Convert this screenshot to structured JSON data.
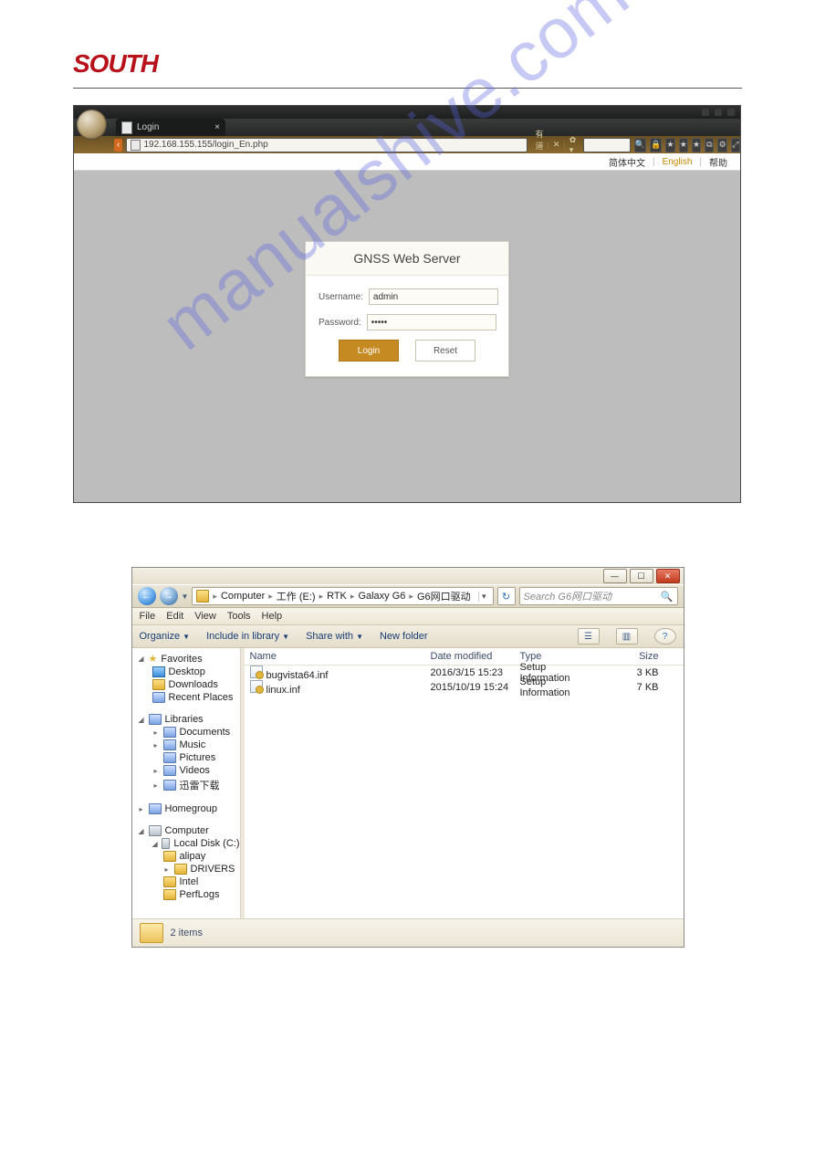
{
  "logo_text": "SOUTH",
  "watermark": "manualshive.com",
  "browser": {
    "tab_title": "Login",
    "url": "192.168.155.155/login_En.php",
    "url_right_1": "有道 ▾",
    "url_right_2": "✕",
    "url_right_3": "✿ ▾",
    "search_icon": "🔍",
    "toolbar_icons": [
      "🔒",
      "★",
      "★",
      "★",
      "⧉",
      "⚙",
      "⤢"
    ],
    "lang_cn": "简体中文",
    "lang_en": "English",
    "lang_help": "帮助"
  },
  "login": {
    "title": "GNSS Web Server",
    "username_label": "Username:",
    "password_label": "Password:",
    "username_value": "admin",
    "password_value": "•••••",
    "login_btn": "Login",
    "reset_btn": "Reset"
  },
  "explorer": {
    "win_min": "—",
    "win_max": "☐",
    "win_close": "✕",
    "back": "←",
    "forward": "→",
    "crumbs": [
      "Computer",
      "工作 (E:)",
      "RTK",
      "Galaxy G6",
      "G6网口驱动"
    ],
    "refresh": "↻",
    "search_placeholder": "Search G6网口驱动",
    "menu": [
      "File",
      "Edit",
      "View",
      "Tools",
      "Help"
    ],
    "toolbar": {
      "organize": "Organize",
      "include": "Include in library",
      "share": "Share with",
      "newfolder": "New folder",
      "view_icon": "☰",
      "preview_icon": "▥",
      "help_icon": "?"
    },
    "columns": {
      "name": "Name",
      "date": "Date modified",
      "type": "Type",
      "size": "Size"
    },
    "files": [
      {
        "name": "bugvista64.inf",
        "date": "2016/3/15 15:23",
        "type": "Setup Information",
        "size": "3 KB"
      },
      {
        "name": "linux.inf",
        "date": "2015/10/19 15:24",
        "type": "Setup Information",
        "size": "7 KB"
      }
    ],
    "tree": {
      "favorites": "Favorites",
      "desktop": "Desktop",
      "downloads": "Downloads",
      "recent": "Recent Places",
      "libraries": "Libraries",
      "documents": "Documents",
      "music": "Music",
      "pictures": "Pictures",
      "videos": "Videos",
      "xunlei": "迅雷下载",
      "homegroup": "Homegroup",
      "computer": "Computer",
      "localc": "Local Disk (C:)",
      "alipay": "alipay",
      "drivers": "DRIVERS",
      "intel": "Intel",
      "perflogs": "PerfLogs"
    },
    "status": "2 items"
  }
}
